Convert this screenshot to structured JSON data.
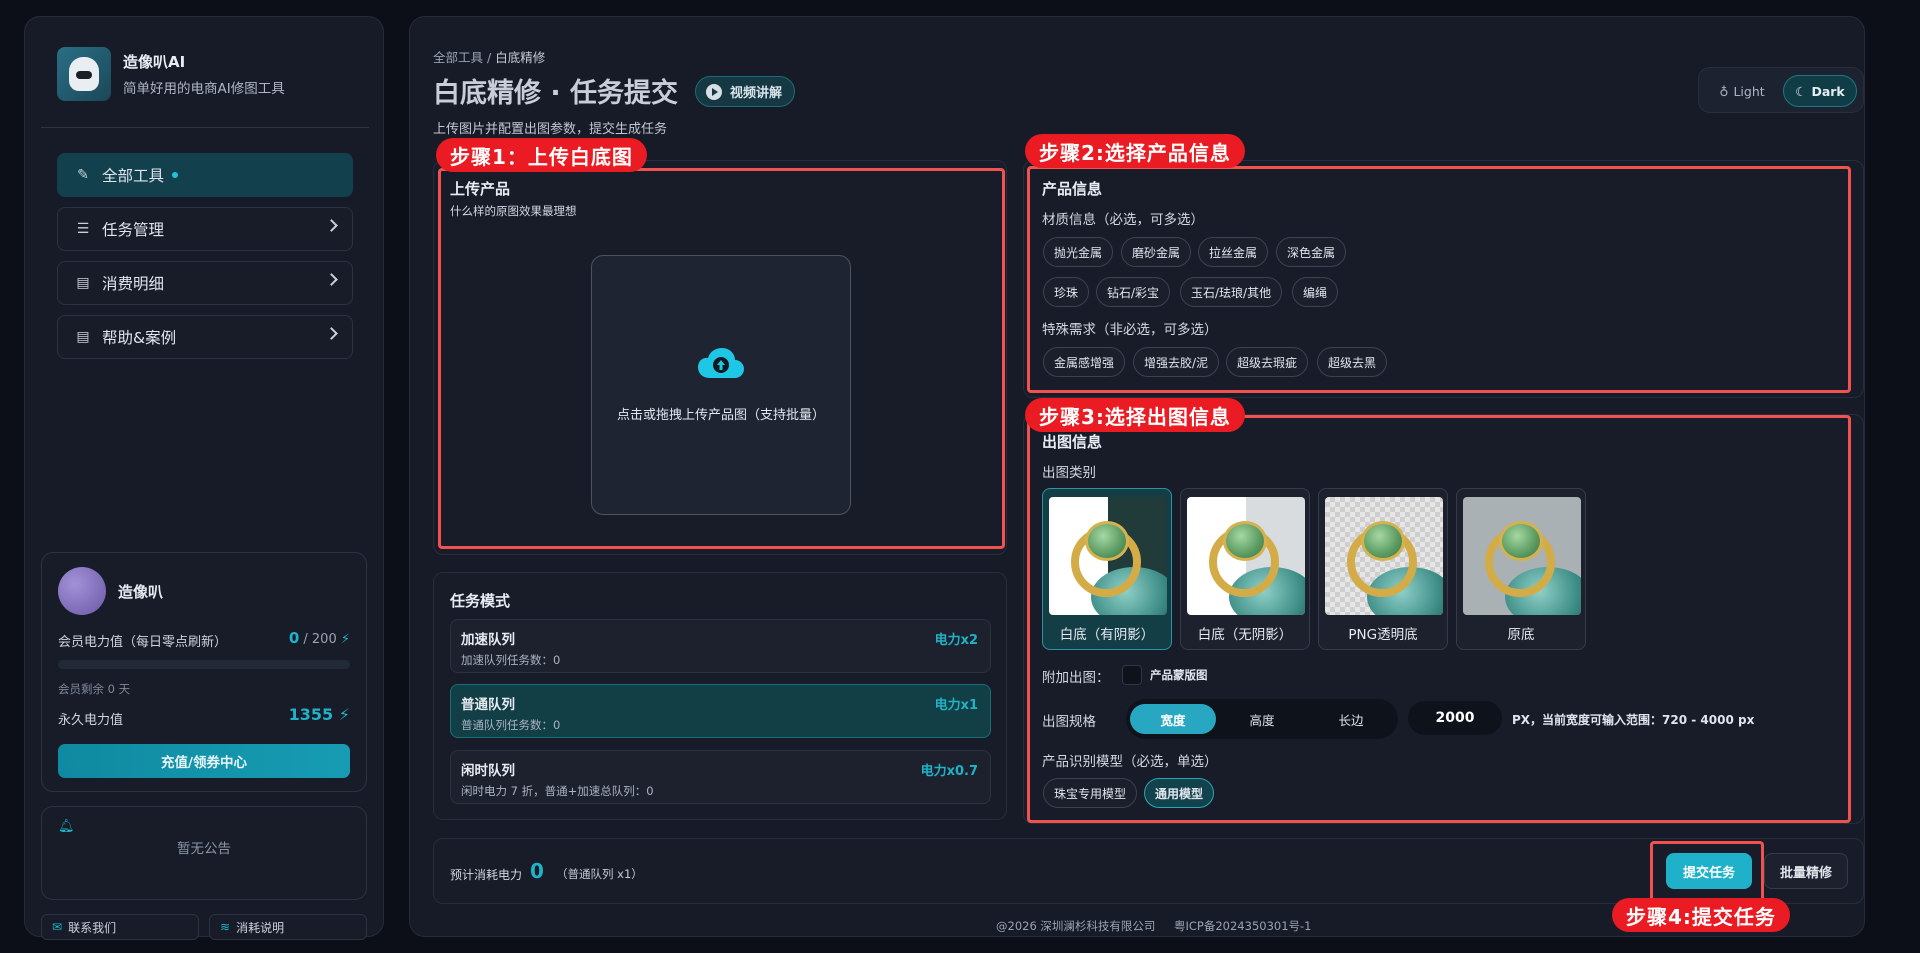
{
  "brand": {
    "name": "造像叭AI",
    "tagline": "简单好用的电商AI修图工具"
  },
  "nav": [
    {
      "label": "全部工具",
      "icon": "brush-icon"
    },
    {
      "label": "任务管理",
      "icon": "list-icon"
    },
    {
      "label": "消费明细",
      "icon": "receipt-icon"
    },
    {
      "label": "帮助&案例",
      "icon": "book-icon"
    }
  ],
  "user": {
    "name": "造像叭",
    "member_power_label": "会员电力值（每日零点刷新）",
    "member_power_value": "0",
    "member_power_max": "/ 200",
    "member_remaining": "会员剩余 0 天",
    "perm_power_label": "永久电力值",
    "perm_power_value": "1355",
    "recharge_label": "充值/领券中心"
  },
  "notice": {
    "text": "暂无公告"
  },
  "footer_links": {
    "contact": "联系我们",
    "consume_info": "消耗说明"
  },
  "header": {
    "breadcrumb_root": "全部工具",
    "breadcrumb_sep": "/",
    "breadcrumb_current": "白底精修",
    "title": "白底精修 · 任务提交",
    "video_label": "视频讲解",
    "subtitle": "上传图片并配置出图参数，提交生成任务",
    "theme_light": "Light",
    "theme_dark": "Dark"
  },
  "steps": {
    "s1": "步骤1：上传白底图",
    "s2": "步骤2:选择产品信息",
    "s3": "步骤3:选择出图信息",
    "s4": "步骤4:提交任务"
  },
  "upload": {
    "title": "上传产品",
    "hint": "什么样的原图效果最理想",
    "dropzone_text": "点击或拖拽上传产品图（支持批量）"
  },
  "task_mode": {
    "title": "任务模式",
    "queues": [
      {
        "name": "加速队列",
        "desc": "加速队列任务数：0",
        "power": "电力x2"
      },
      {
        "name": "普通队列",
        "desc": "普通队列任务数：0",
        "power": "电力x1"
      },
      {
        "name": "闲时队列",
        "desc": "闲时电力 7 折，普通+加速总队列：0",
        "power": "电力x0.7"
      }
    ]
  },
  "product_info": {
    "title": "产品信息",
    "material_label": "材质信息（必选，可多选）",
    "materials": [
      "抛光金属",
      "磨砂金属",
      "拉丝金属",
      "深色金属",
      "珍珠",
      "钻石/彩宝",
      "玉石/珐琅/其他",
      "编绳"
    ],
    "special_label": "特殊需求（非必选，可多选）",
    "specials": [
      "金属感增强",
      "增强去胶/泥",
      "超级去瑕疵",
      "超级去黑"
    ]
  },
  "output_info": {
    "title": "出图信息",
    "category_label": "出图类别",
    "categories": [
      "白底（有阴影）",
      "白底（无阴影）",
      "PNG透明底",
      "原底"
    ],
    "extra_label": "附加出图：",
    "extra_option": "产品蒙版图",
    "spec_label": "出图规格",
    "spec_options": [
      "宽度",
      "高度",
      "长边"
    ],
    "spec_value": "2000",
    "spec_hint": "PX，当前宽度可输入范围：720 - 4000 px",
    "model_label": "产品识别模型（必选，单选）",
    "models": [
      "珠宝专用模型",
      "通用模型"
    ]
  },
  "submit_bar": {
    "estimate_label": "预计消耗电力",
    "estimate_value": "0",
    "estimate_note": "（普通队列 x1）",
    "submit_label": "提交任务",
    "batch_label": "批量精修"
  },
  "page_footer": {
    "company": "@2026 深圳澜杉科技有限公司",
    "icp": "粤ICP备2024350301号-1"
  },
  "colors": {
    "accent": "#1fb1ca",
    "step_red": "#ea1b22",
    "frame_red": "#f0524f"
  }
}
